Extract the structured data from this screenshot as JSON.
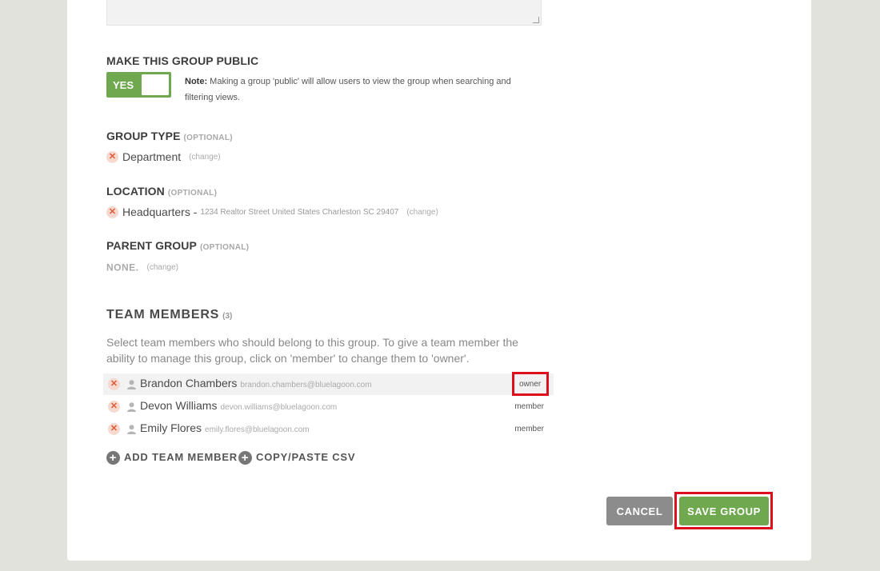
{
  "public": {
    "title": "MAKE THIS GROUP PUBLIC",
    "toggle_label": "YES",
    "note_label": "Note:",
    "note_text": " Making a group 'public' will allow users to view the group when searching and filtering views."
  },
  "group_type": {
    "title": "GROUP TYPE",
    "optional": "(OPTIONAL)",
    "value": "Department",
    "change": "(change)"
  },
  "location": {
    "title": "LOCATION",
    "optional": "(OPTIONAL)",
    "value": "Headquarters -",
    "address": "1234 Realtor Street United States Charleston SC 29407",
    "change": "(change)"
  },
  "parent_group": {
    "title": "PARENT GROUP",
    "optional": "(OPTIONAL)",
    "value": "NONE.",
    "change": "(change)"
  },
  "team": {
    "title": "TEAM MEMBERS",
    "count": "(3)",
    "description": "Select team members who should belong to this group. To give a team member the ability to manage this group, click on 'member' to change them to 'owner'.",
    "members": [
      {
        "name": "Brandon Chambers",
        "email": "brandon.chambers@bluelagoon.com",
        "role": "owner"
      },
      {
        "name": "Devon Williams",
        "email": "devon.williams@bluelagoon.com",
        "role": "member"
      },
      {
        "name": "Emily Flores",
        "email": "emily.flores@bluelagoon.com",
        "role": "member"
      }
    ],
    "add_member": "ADD TEAM MEMBER",
    "copy_csv": "COPY/PASTE CSV"
  },
  "actions": {
    "cancel": "CANCEL",
    "save": "SAVE GROUP"
  },
  "colors": {
    "accent_green": "#6fa84f",
    "cancel_gray": "#8c8c8c",
    "highlight_red": "#dc0f1c",
    "remove_red": "#e0583a"
  }
}
